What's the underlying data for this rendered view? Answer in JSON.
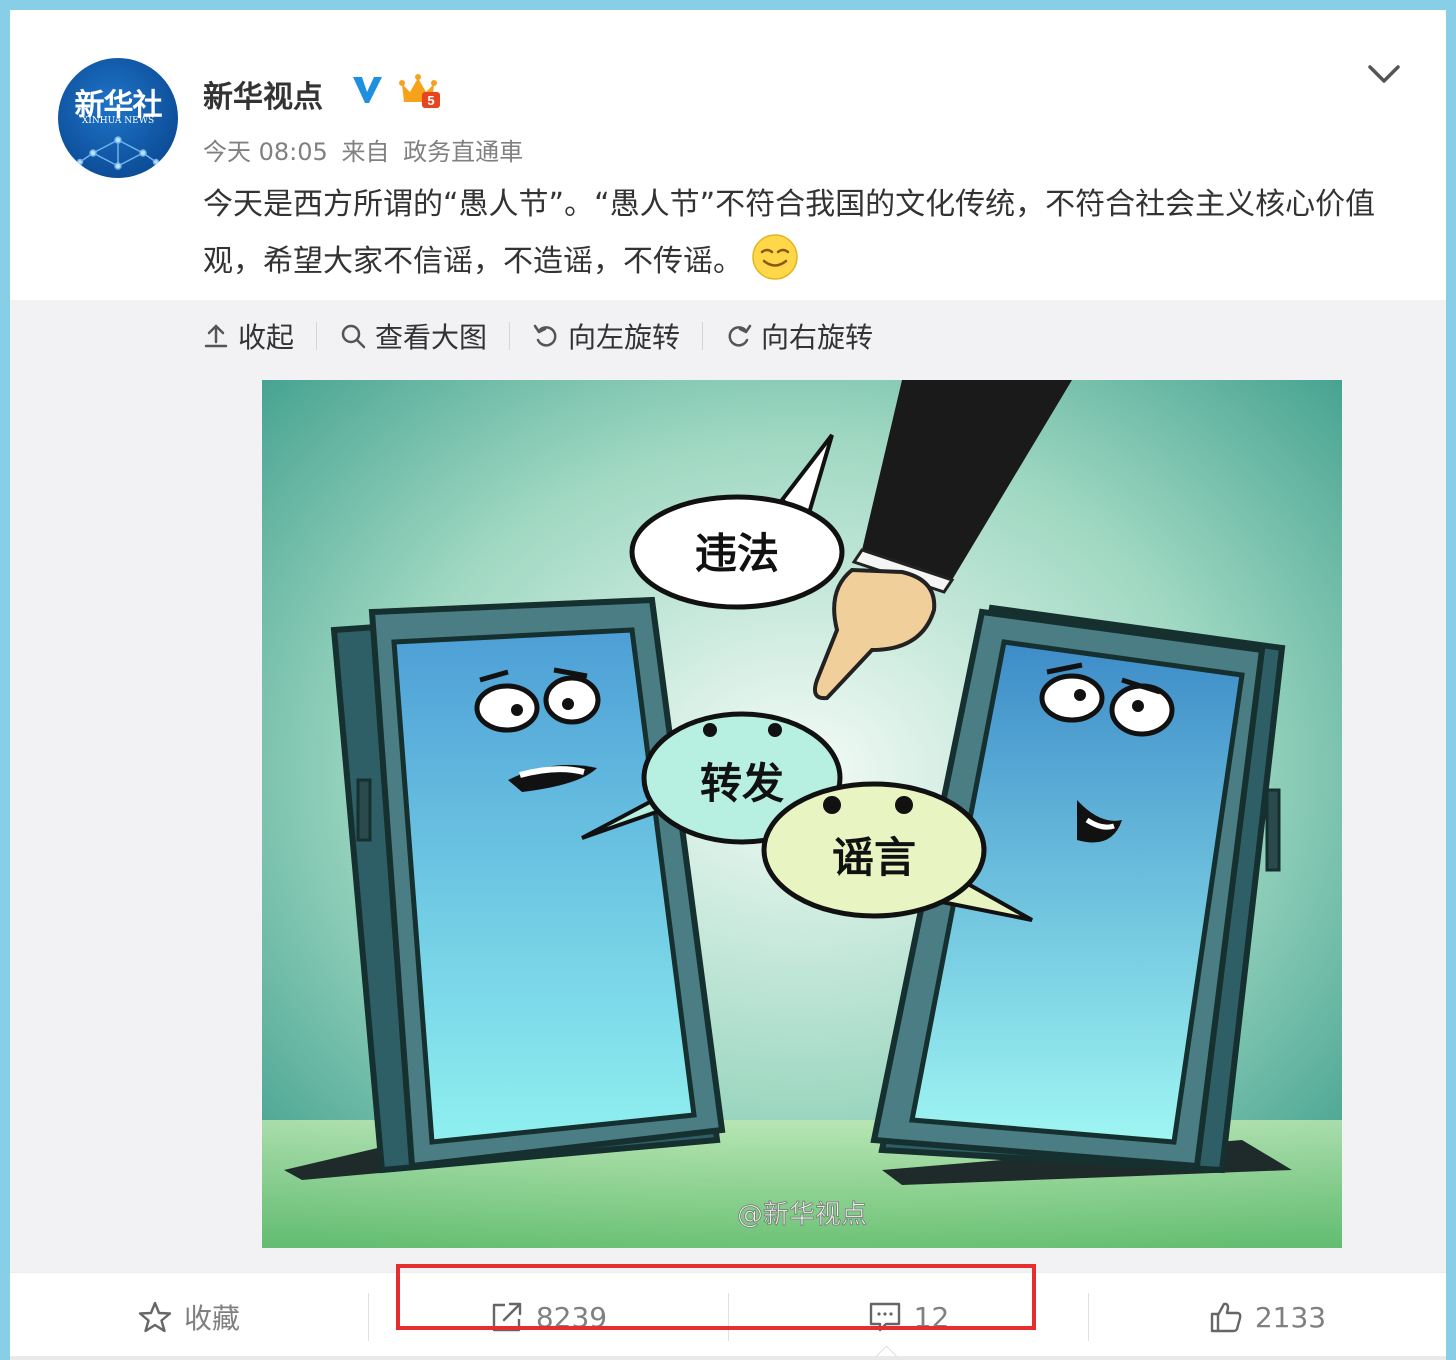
{
  "post": {
    "avatar": {
      "logo_text": "新华社",
      "logo_sub": "XINHUA NEWS"
    },
    "username": "新华视点",
    "verify_icon": "verified-v-icon",
    "member_icon": "vip-crown-icon",
    "member_level": "5",
    "time": "今天 08:05",
    "from_label": "来自",
    "source": "政务直通車",
    "text": "今天是西方所谓的“愚人节”。“愚人节”不符合我国的文化传统，不符合社会主义核心价值观，希望大家不信谣，不造谣，不传谣。",
    "emoji": "smile-emoji-icon"
  },
  "media_toolbar": {
    "collapse": "收起",
    "view_large": "查看大图",
    "rotate_left": "向左旋转",
    "rotate_right": "向右旋转"
  },
  "image": {
    "bubble_top": "违法",
    "bubble_middle": "转发",
    "bubble_right": "谣言",
    "watermark": "@新华视点"
  },
  "actions": {
    "favorite": "收藏",
    "repost_count": "8239",
    "comment_count": "12",
    "like_count": "2133"
  },
  "colors": {
    "page_bg": "#86cfe6",
    "verify_blue": "#1e8fe1",
    "highlight_red": "#e62e2e"
  }
}
